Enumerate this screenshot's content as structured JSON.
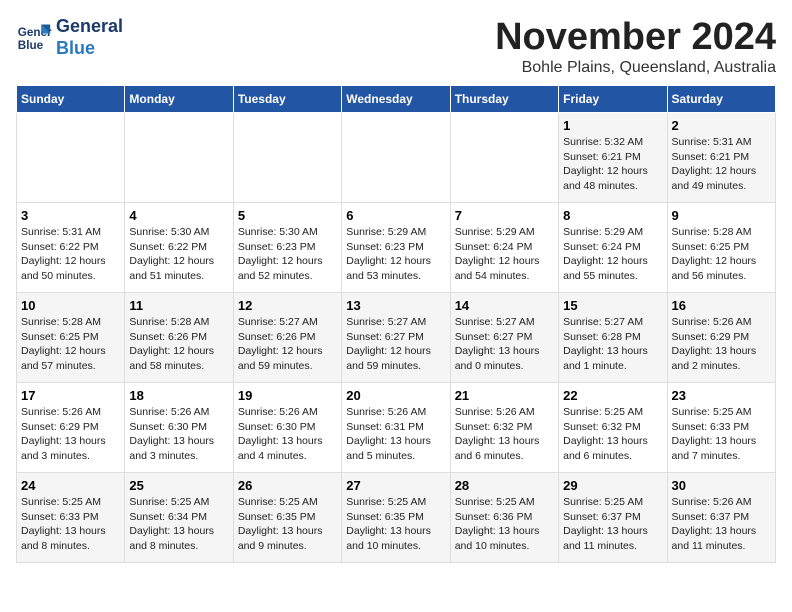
{
  "logo": {
    "line1": "General",
    "line2": "Blue"
  },
  "title": "November 2024",
  "location": "Bohle Plains, Queensland, Australia",
  "headers": [
    "Sunday",
    "Monday",
    "Tuesday",
    "Wednesday",
    "Thursday",
    "Friday",
    "Saturday"
  ],
  "weeks": [
    [
      {
        "day": "",
        "info": ""
      },
      {
        "day": "",
        "info": ""
      },
      {
        "day": "",
        "info": ""
      },
      {
        "day": "",
        "info": ""
      },
      {
        "day": "",
        "info": ""
      },
      {
        "day": "1",
        "info": "Sunrise: 5:32 AM\nSunset: 6:21 PM\nDaylight: 12 hours\nand 48 minutes."
      },
      {
        "day": "2",
        "info": "Sunrise: 5:31 AM\nSunset: 6:21 PM\nDaylight: 12 hours\nand 49 minutes."
      }
    ],
    [
      {
        "day": "3",
        "info": "Sunrise: 5:31 AM\nSunset: 6:22 PM\nDaylight: 12 hours\nand 50 minutes."
      },
      {
        "day": "4",
        "info": "Sunrise: 5:30 AM\nSunset: 6:22 PM\nDaylight: 12 hours\nand 51 minutes."
      },
      {
        "day": "5",
        "info": "Sunrise: 5:30 AM\nSunset: 6:23 PM\nDaylight: 12 hours\nand 52 minutes."
      },
      {
        "day": "6",
        "info": "Sunrise: 5:29 AM\nSunset: 6:23 PM\nDaylight: 12 hours\nand 53 minutes."
      },
      {
        "day": "7",
        "info": "Sunrise: 5:29 AM\nSunset: 6:24 PM\nDaylight: 12 hours\nand 54 minutes."
      },
      {
        "day": "8",
        "info": "Sunrise: 5:29 AM\nSunset: 6:24 PM\nDaylight: 12 hours\nand 55 minutes."
      },
      {
        "day": "9",
        "info": "Sunrise: 5:28 AM\nSunset: 6:25 PM\nDaylight: 12 hours\nand 56 minutes."
      }
    ],
    [
      {
        "day": "10",
        "info": "Sunrise: 5:28 AM\nSunset: 6:25 PM\nDaylight: 12 hours\nand 57 minutes."
      },
      {
        "day": "11",
        "info": "Sunrise: 5:28 AM\nSunset: 6:26 PM\nDaylight: 12 hours\nand 58 minutes."
      },
      {
        "day": "12",
        "info": "Sunrise: 5:27 AM\nSunset: 6:26 PM\nDaylight: 12 hours\nand 59 minutes."
      },
      {
        "day": "13",
        "info": "Sunrise: 5:27 AM\nSunset: 6:27 PM\nDaylight: 12 hours\nand 59 minutes."
      },
      {
        "day": "14",
        "info": "Sunrise: 5:27 AM\nSunset: 6:27 PM\nDaylight: 13 hours\nand 0 minutes."
      },
      {
        "day": "15",
        "info": "Sunrise: 5:27 AM\nSunset: 6:28 PM\nDaylight: 13 hours\nand 1 minute."
      },
      {
        "day": "16",
        "info": "Sunrise: 5:26 AM\nSunset: 6:29 PM\nDaylight: 13 hours\nand 2 minutes."
      }
    ],
    [
      {
        "day": "17",
        "info": "Sunrise: 5:26 AM\nSunset: 6:29 PM\nDaylight: 13 hours\nand 3 minutes."
      },
      {
        "day": "18",
        "info": "Sunrise: 5:26 AM\nSunset: 6:30 PM\nDaylight: 13 hours\nand 3 minutes."
      },
      {
        "day": "19",
        "info": "Sunrise: 5:26 AM\nSunset: 6:30 PM\nDaylight: 13 hours\nand 4 minutes."
      },
      {
        "day": "20",
        "info": "Sunrise: 5:26 AM\nSunset: 6:31 PM\nDaylight: 13 hours\nand 5 minutes."
      },
      {
        "day": "21",
        "info": "Sunrise: 5:26 AM\nSunset: 6:32 PM\nDaylight: 13 hours\nand 6 minutes."
      },
      {
        "day": "22",
        "info": "Sunrise: 5:25 AM\nSunset: 6:32 PM\nDaylight: 13 hours\nand 6 minutes."
      },
      {
        "day": "23",
        "info": "Sunrise: 5:25 AM\nSunset: 6:33 PM\nDaylight: 13 hours\nand 7 minutes."
      }
    ],
    [
      {
        "day": "24",
        "info": "Sunrise: 5:25 AM\nSunset: 6:33 PM\nDaylight: 13 hours\nand 8 minutes."
      },
      {
        "day": "25",
        "info": "Sunrise: 5:25 AM\nSunset: 6:34 PM\nDaylight: 13 hours\nand 8 minutes."
      },
      {
        "day": "26",
        "info": "Sunrise: 5:25 AM\nSunset: 6:35 PM\nDaylight: 13 hours\nand 9 minutes."
      },
      {
        "day": "27",
        "info": "Sunrise: 5:25 AM\nSunset: 6:35 PM\nDaylight: 13 hours\nand 10 minutes."
      },
      {
        "day": "28",
        "info": "Sunrise: 5:25 AM\nSunset: 6:36 PM\nDaylight: 13 hours\nand 10 minutes."
      },
      {
        "day": "29",
        "info": "Sunrise: 5:25 AM\nSunset: 6:37 PM\nDaylight: 13 hours\nand 11 minutes."
      },
      {
        "day": "30",
        "info": "Sunrise: 5:26 AM\nSunset: 6:37 PM\nDaylight: 13 hours\nand 11 minutes."
      }
    ]
  ]
}
